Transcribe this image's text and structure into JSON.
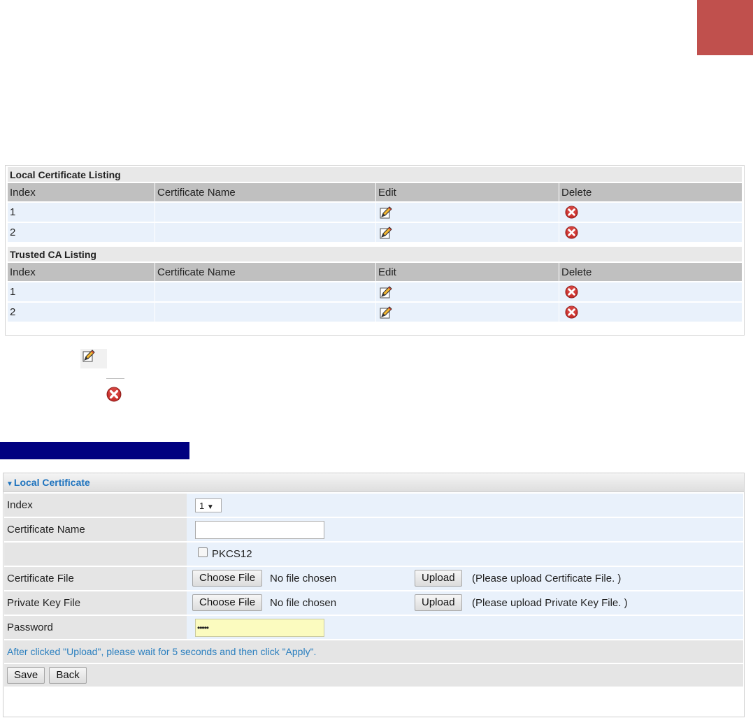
{
  "colors": {
    "corner_block": "#c0504d",
    "navy_bar": "#000080",
    "accent": "#1e73be"
  },
  "listing": {
    "local_title": "Local Certificate Listing",
    "trusted_title": "Trusted CA Listing",
    "headers": [
      "Index",
      "Certificate Name",
      "Edit",
      "Delete"
    ],
    "local_rows": [
      {
        "index": "1",
        "name": ""
      },
      {
        "index": "2",
        "name": ""
      }
    ],
    "trusted_rows": [
      {
        "index": "1",
        "name": ""
      },
      {
        "index": "2",
        "name": ""
      }
    ]
  },
  "icons": {
    "edit": "edit-pen-icon",
    "delete": "delete-x-icon"
  },
  "form": {
    "title": "Local Certificate",
    "index_label": "Index",
    "index_value": "1",
    "cert_name_label": "Certificate Name",
    "cert_name_value": "",
    "pkcs12_label": "PKCS12",
    "cert_file_label": "Certificate File",
    "private_key_label": "Private Key File",
    "choose_file_label": "Choose File",
    "no_file_text": "No file chosen",
    "upload_label": "Upload",
    "cert_file_hint": "(Please upload Certificate File. )",
    "private_key_hint": "(Please upload Private Key File. )",
    "password_label": "Password",
    "password_value": "•••••",
    "note": "After clicked \"Upload\", please wait for 5 seconds and then click \"Apply\".",
    "save_label": "Save",
    "back_label": "Back"
  }
}
